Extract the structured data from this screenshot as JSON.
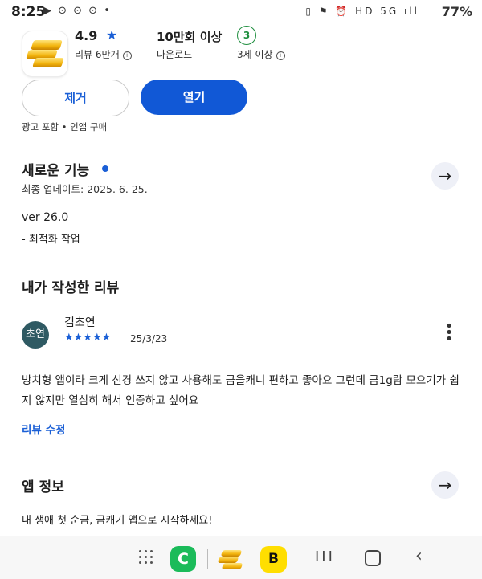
{
  "status_bar": {
    "time": "8:25",
    "left_icons": "▶ ⊙ ⊙ ⊙ •",
    "right_icons": "▯ ⚑ ⏰ HD 5G ıll",
    "battery": "77%"
  },
  "app_header": {
    "icon_name": "gold-bars-app-icon",
    "rating": "4.9",
    "rating_star": "★",
    "reviews_label": "리뷰 6만개",
    "downloads": "10만회 이상",
    "downloads_label": "다운로드",
    "age_badge": "3",
    "age_label": "3세 이상"
  },
  "actions": {
    "remove_label": "제거",
    "open_label": "열기",
    "ads_note": "광고 포함 • 인앱 구매"
  },
  "whats_new": {
    "title": "새로운 기능",
    "updated": "최종 업데이트: 2025. 6. 25.",
    "version": "ver 26.0",
    "note": "- 최적화 작업",
    "arrow": "→"
  },
  "my_review": {
    "title": "내가 작성한 리뷰",
    "avatar_text": "초연",
    "author": "김초연",
    "stars": "★★★★★",
    "rating": 5,
    "date": "25/3/23",
    "text": "방치형 앱이라 크게 신경 쓰지 않고 사용해도 금을캐니 편하고 좋아요 그런데 금1g람 모으기가 쉽지 않지만 열심히 해서 인증하고 싶어요",
    "edit_label": "리뷰 수정",
    "menu": "⋮"
  },
  "app_info": {
    "title": "앱 정보",
    "arrow": "→",
    "tagline": "내 생애 첫 순금, 금캐기 앱으로 시작하세요!"
  },
  "nav_bar": {
    "app_c_label": "C",
    "app_b_label": "B",
    "recent": "III",
    "back": "‹"
  },
  "colors": {
    "accent": "#1158d6",
    "link": "#1a5fd6",
    "age_green": "#1e8e3e",
    "avatar_bg": "#2f5a63"
  }
}
